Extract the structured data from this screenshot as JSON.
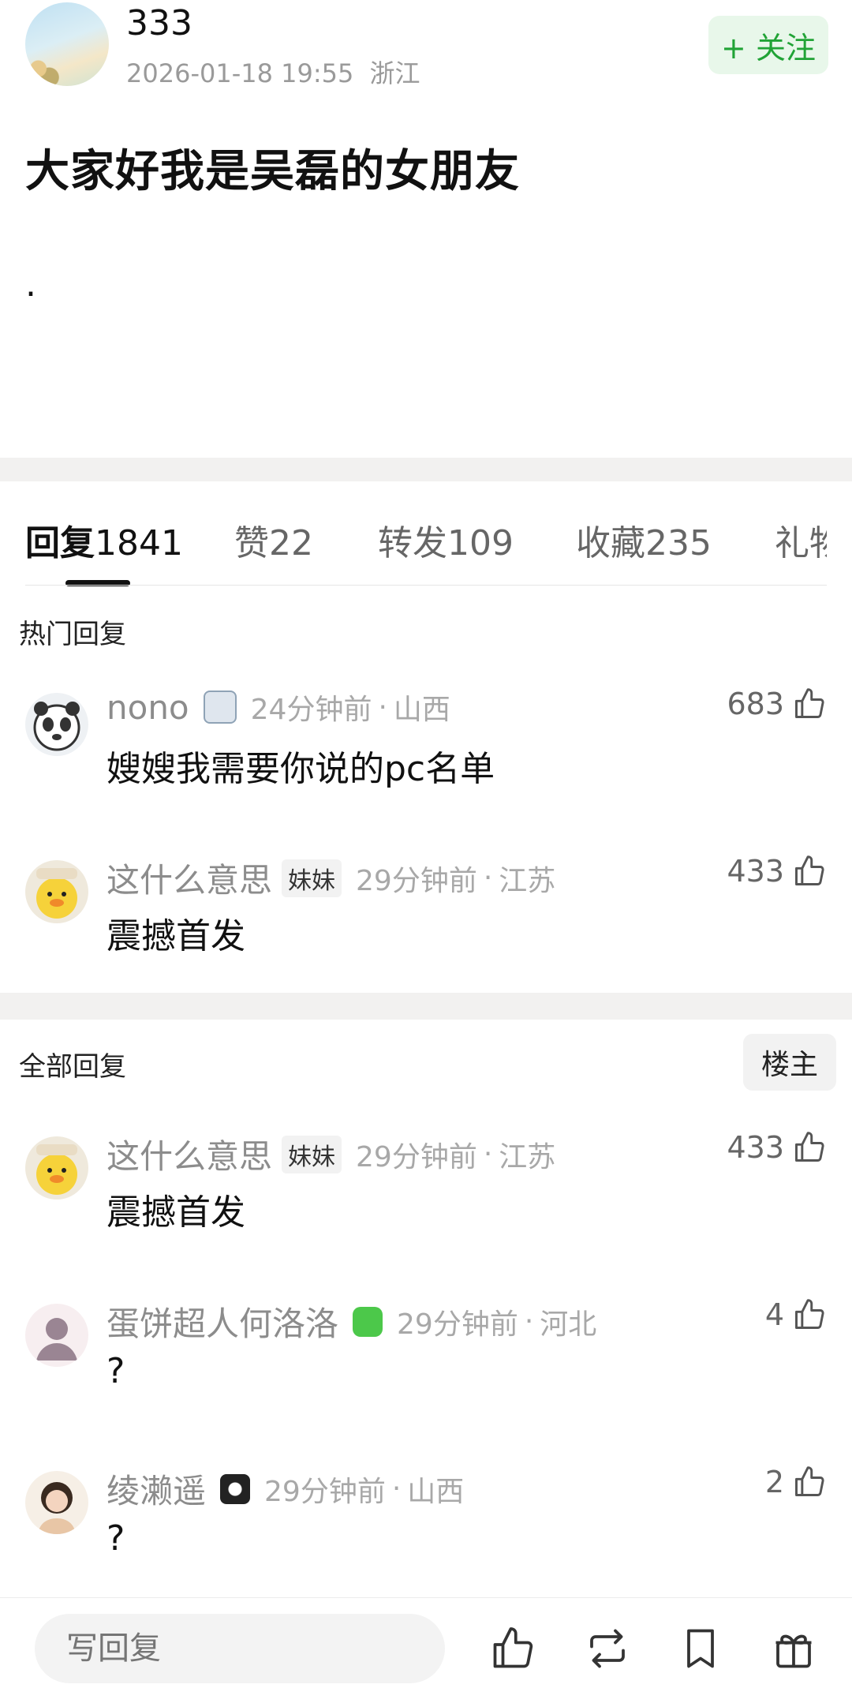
{
  "post": {
    "author": "333",
    "datetime": "2026-01-18 19:55",
    "location": "浙江",
    "follow_label": "+ 关注",
    "title": "大家好我是吴磊的女朋友",
    "body": "."
  },
  "tabs": [
    {
      "label": "回复",
      "count": "1841"
    },
    {
      "label": "赞",
      "count": "22"
    },
    {
      "label": "转发",
      "count": "109"
    },
    {
      "label": "收藏",
      "count": "235"
    },
    {
      "label": "礼物",
      "count": ""
    }
  ],
  "hot_section": {
    "label": "热门回复"
  },
  "all_section": {
    "label": "全部回复",
    "filter_label": "楼主"
  },
  "hot_comments": [
    {
      "name": "nono",
      "badge": "",
      "time": "24分钟前",
      "location": "山西",
      "likes": "683",
      "text": "嫂嫂我需要你说的pc名单",
      "avatar": "panda-avatar"
    },
    {
      "name": "这什么意思",
      "badge": "妹妹",
      "time": "29分钟前",
      "location": "江苏",
      "likes": "433",
      "text": "震撼首发",
      "avatar": "duck-avatar"
    }
  ],
  "all_comments": [
    {
      "name": "这什么意思",
      "badge": "妹妹",
      "time": "29分钟前",
      "location": "江苏",
      "likes": "433",
      "text": "震撼首发",
      "avatar": "duck-avatar"
    },
    {
      "name": "蛋饼超人何洛洛",
      "badge": "",
      "time": "29分钟前",
      "location": "河北",
      "likes": "4",
      "text": "?",
      "avatar": "default-avatar"
    },
    {
      "name": "绫濑遥",
      "badge": "",
      "time": "29分钟前",
      "location": "山西",
      "likes": "2",
      "text": "?",
      "avatar": "girl-avatar"
    }
  ],
  "bottom_bar": {
    "reply_placeholder": "写回复",
    "icons": [
      "like-icon",
      "repost-icon",
      "bookmark-icon",
      "gift-icon"
    ]
  },
  "colors": {
    "follow_green": "#21a336",
    "follow_bg": "#e8f7ea",
    "gap_gray": "#f2f1f0"
  }
}
